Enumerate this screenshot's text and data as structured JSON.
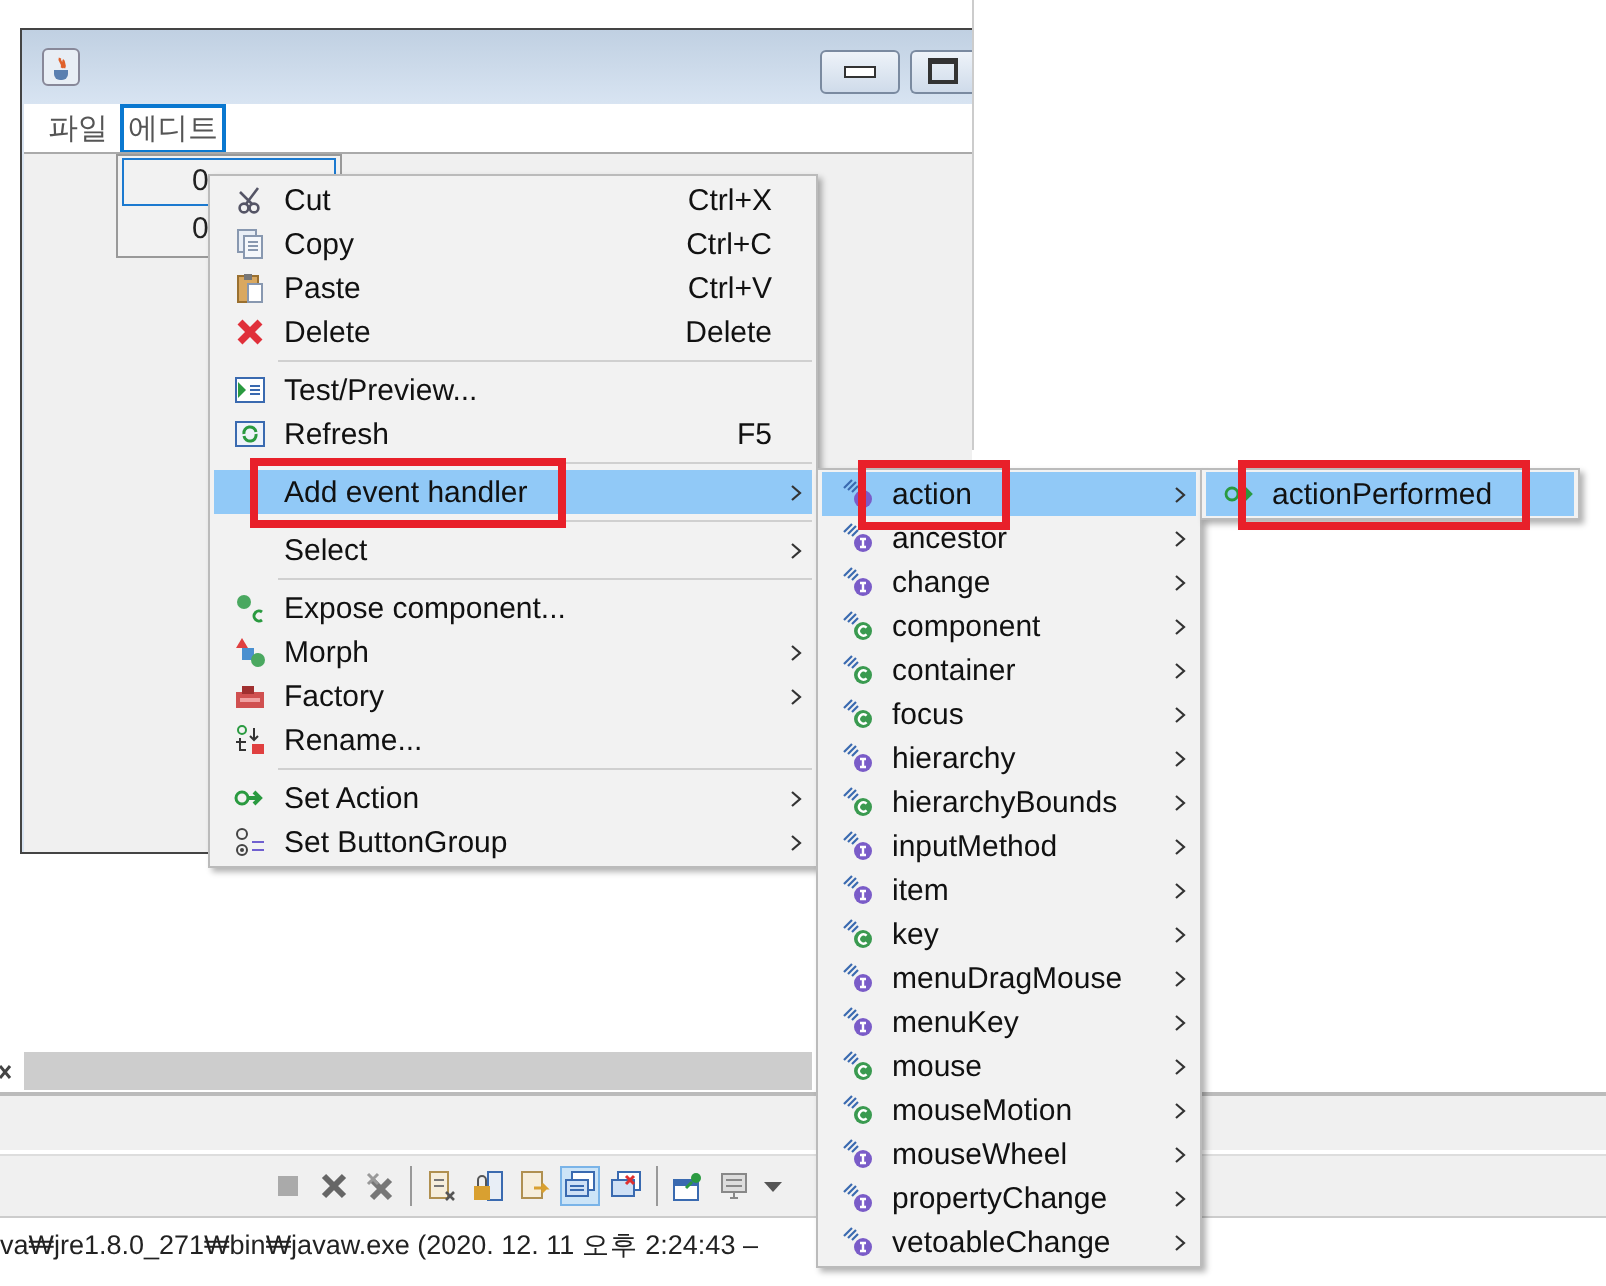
{
  "menubar": [
    {
      "label": "파일",
      "selected": false
    },
    {
      "label": "에디트",
      "selected": true
    }
  ],
  "dropdown": {
    "items": [
      {
        "label": "0",
        "selected": true
      },
      {
        "label": "0",
        "selected": false
      }
    ]
  },
  "context_menu": {
    "items": [
      {
        "kind": "item",
        "label": "Cut",
        "shortcut": "Ctrl+X",
        "submenu": false,
        "selected": false,
        "annotated": false
      },
      {
        "kind": "item",
        "label": "Copy",
        "shortcut": "Ctrl+C",
        "submenu": false,
        "selected": false,
        "annotated": false
      },
      {
        "kind": "item",
        "label": "Paste",
        "shortcut": "Ctrl+V",
        "submenu": false,
        "selected": false,
        "annotated": false
      },
      {
        "kind": "item",
        "label": "Delete",
        "shortcut": "Delete",
        "submenu": false,
        "selected": false,
        "annotated": false
      },
      {
        "kind": "separator"
      },
      {
        "kind": "item",
        "label": "Test/Preview...",
        "submenu": false,
        "selected": false,
        "annotated": false
      },
      {
        "kind": "item",
        "label": "Refresh",
        "shortcut": "F5",
        "submenu": false,
        "selected": false,
        "annotated": false
      },
      {
        "kind": "separator"
      },
      {
        "kind": "item",
        "label": "Add event handler",
        "submenu": true,
        "selected": true,
        "annotated": true
      },
      {
        "kind": "separator"
      },
      {
        "kind": "item",
        "label": "Select",
        "submenu": true,
        "selected": false,
        "annotated": false
      },
      {
        "kind": "separator"
      },
      {
        "kind": "item",
        "label": "Expose component...",
        "submenu": false,
        "selected": false,
        "annotated": false
      },
      {
        "kind": "item",
        "label": "Morph",
        "submenu": true,
        "selected": false,
        "annotated": false
      },
      {
        "kind": "item",
        "label": "Factory",
        "submenu": true,
        "selected": false,
        "annotated": false
      },
      {
        "kind": "item",
        "label": "Rename...",
        "submenu": false,
        "selected": false,
        "annotated": false
      },
      {
        "kind": "separator"
      },
      {
        "kind": "item",
        "label": "Set Action",
        "submenu": true,
        "selected": false,
        "annotated": false
      },
      {
        "kind": "item",
        "label": "Set ButtonGroup",
        "submenu": true,
        "selected": false,
        "annotated": false
      }
    ]
  },
  "event_submenu": {
    "items": [
      {
        "label": "action",
        "kind": "interface",
        "selected": true,
        "annotated": true
      },
      {
        "label": "ancestor",
        "kind": "interface",
        "selected": false,
        "annotated": false
      },
      {
        "label": "change",
        "kind": "interface",
        "selected": false,
        "annotated": false
      },
      {
        "label": "component",
        "kind": "class",
        "selected": false,
        "annotated": false
      },
      {
        "label": "container",
        "kind": "class",
        "selected": false,
        "annotated": false
      },
      {
        "label": "focus",
        "kind": "class",
        "selected": false,
        "annotated": false
      },
      {
        "label": "hierarchy",
        "kind": "interface",
        "selected": false,
        "annotated": false
      },
      {
        "label": "hierarchyBounds",
        "kind": "class",
        "selected": false,
        "annotated": false
      },
      {
        "label": "inputMethod",
        "kind": "interface",
        "selected": false,
        "annotated": false
      },
      {
        "label": "item",
        "kind": "interface",
        "selected": false,
        "annotated": false
      },
      {
        "label": "key",
        "kind": "class",
        "selected": false,
        "annotated": false
      },
      {
        "label": "menuDragMouse",
        "kind": "interface",
        "selected": false,
        "annotated": false
      },
      {
        "label": "menuKey",
        "kind": "interface",
        "selected": false,
        "annotated": false
      },
      {
        "label": "mouse",
        "kind": "class",
        "selected": false,
        "annotated": false
      },
      {
        "label": "mouseMotion",
        "kind": "class",
        "selected": false,
        "annotated": false
      },
      {
        "label": "mouseWheel",
        "kind": "interface",
        "selected": false,
        "annotated": false
      },
      {
        "label": "propertyChange",
        "kind": "interface",
        "selected": false,
        "annotated": false
      },
      {
        "label": "vetoableChange",
        "kind": "interface",
        "selected": false,
        "annotated": false
      }
    ]
  },
  "method_submenu": {
    "items": [
      {
        "label": "actionPerformed",
        "selected": true,
        "annotated": true
      }
    ]
  },
  "toolbar": [
    {
      "selected": false
    },
    {
      "selected": false
    },
    {
      "selected": false
    },
    {
      "selected": false
    },
    {
      "selected": false
    },
    {
      "selected": false
    },
    {
      "selected": true
    },
    {
      "selected": false
    },
    {
      "selected": false
    },
    {
      "selected": false
    }
  ],
  "console": {
    "text": "va₩jre1.8.0_271₩bin₩javaw.exe  (2020. 12. 11 오후 2:24:43 –"
  }
}
